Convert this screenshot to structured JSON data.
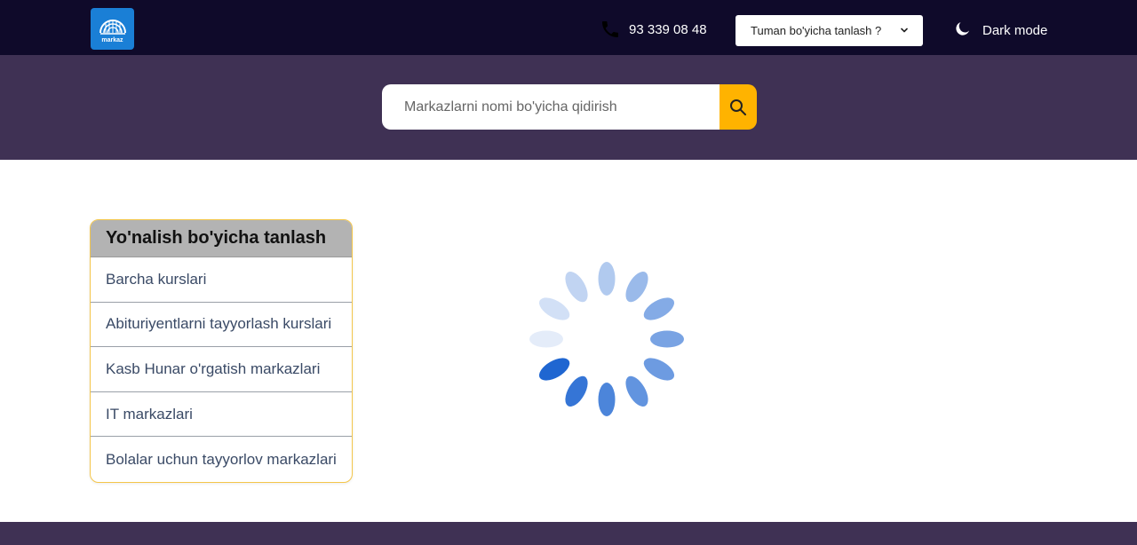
{
  "header": {
    "logo": {
      "text": "markaz",
      "color": "#1a7fd6",
      "icon": "markaz-logo-icon"
    },
    "phone": {
      "icon": "phone-icon",
      "number": "93 339 08 48"
    },
    "district_select": {
      "label": "Tuman bo'yicha tanlash ?",
      "icon": "chevron-down-icon"
    },
    "dark_mode": {
      "icon": "moon-icon",
      "label": "Dark mode"
    },
    "background": "#0f0a2a"
  },
  "search": {
    "placeholder": "Markazlarni nomi bo'yicha qidirish",
    "value": "",
    "button_icon": "search-icon",
    "button_color": "#ffb300",
    "band_color": "#3f3154"
  },
  "categories": {
    "title": "Yo'nalish bo'yicha tanlash",
    "items": [
      {
        "label": "Barcha kurslari"
      },
      {
        "label": "Abituriyentlarni tayyorlash kurslari"
      },
      {
        "label": "Kasb Hunar o'rgatish markazlari"
      },
      {
        "label": "IT markazlari"
      },
      {
        "label": "Bolalar uchun tayyorlov markazlari"
      }
    ],
    "border_color": "#f4c64a"
  },
  "loading": {
    "icon": "loading-spinner-icon",
    "color": "#1f66d1"
  }
}
